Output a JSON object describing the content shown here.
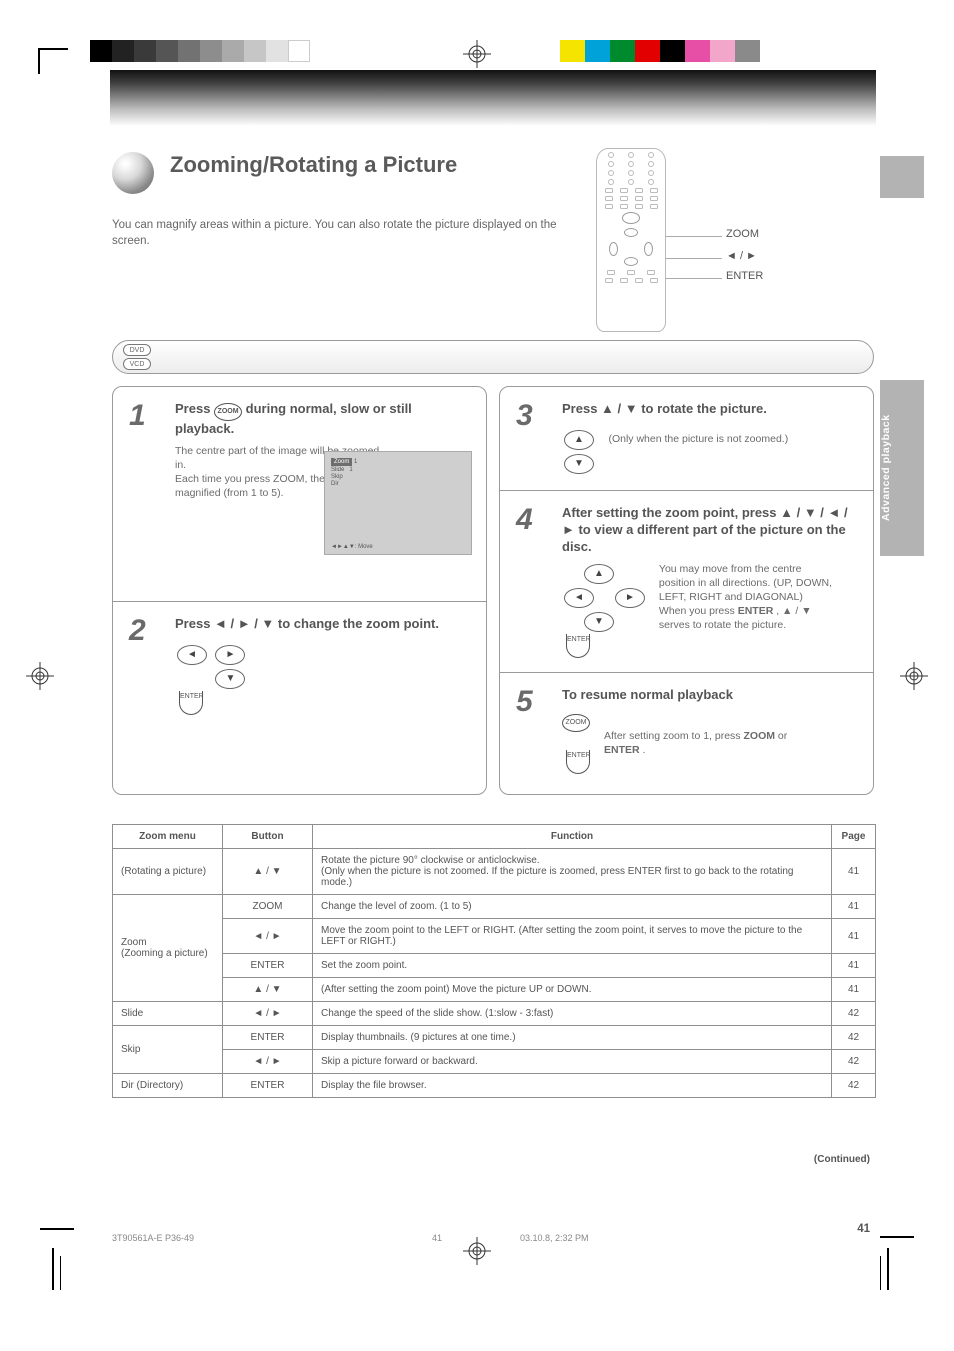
{
  "page_title": "Zooming/Rotating a Picture",
  "subtitle": "You can magnify areas within a picture. You can also rotate the picture displayed on the screen.",
  "side_tab": "Advanced playback",
  "remote_labels": {
    "zoom": "ZOOM",
    "arrows": "◄ / ►",
    "enter": "ENTER"
  },
  "pill": {
    "top": "DVD",
    "bottom": "VCD"
  },
  "steps": [
    {
      "num": "1",
      "title_pre": "Press ",
      "title_btn": "ZOOM",
      "title_post": " during normal, slow or still playback.",
      "body": "The centre part of the image will be zoomed in.\nEach time you press ZOOM, the picture is magnified (from 1 to 5).",
      "screen": {
        "hint": "◄►▲▼: Move",
        "zoom_label": "Zoom",
        "level": "1"
      }
    },
    {
      "num": "2",
      "title": "Press ◄ / ► / ▼ to change the zoom point.",
      "body": "",
      "enter": "ENTER"
    },
    {
      "num": "3",
      "title": "Press ▲ / ▼ to rotate the picture.",
      "body": "(Only when the picture is not zoomed.)"
    },
    {
      "num": "4",
      "title": "After setting the zoom point, press ▲ / ▼ / ◄ / ► to view a different part of the picture on the disc.",
      "body_pre": "You may move from the centre position in all directions. (UP, DOWN, LEFT, RIGHT and DIAGONAL)\nWhen you press ",
      "body_btn": "ENTER",
      "body_post": ", ▲ / ▼ serves to rotate the picture.",
      "enter": "ENTER"
    },
    {
      "num": "5",
      "title": "To resume normal playback",
      "body_pre": "After setting zoom to 1, press ",
      "body_btn1": "ZOOM",
      "body_mid": " or ",
      "body_btn2": "ENTER",
      "body_post": ".",
      "zoom": "ZOOM",
      "enter": "ENTER"
    }
  ],
  "table": {
    "headers": [
      "Zoom menu",
      "Button",
      "Function",
      "Page"
    ],
    "rows": [
      {
        "menu": "(Rotating a picture)",
        "button": "▲ / ▼",
        "function": "Rotate the picture 90° clockwise or anticlockwise.",
        "note": "(Only when the picture is not zoomed. If the picture is zoomed, press ENTER first to go back to the rotating mode.)",
        "page": "41"
      },
      {
        "menu": "Zoom",
        "menu_note": "(Zooming a picture)",
        "sub": [
          {
            "button": "ZOOM",
            "function": "Change the level of zoom. (1 to 5)",
            "page": "41"
          },
          {
            "button": "◄ / ►",
            "function": "Move the zoom point to the LEFT or RIGHT. (After setting the zoom point, it serves to move the picture to the LEFT or RIGHT.)",
            "page": "41"
          },
          {
            "button": "ENTER",
            "function": "Set the zoom point.",
            "page": "41"
          },
          {
            "button": "▲ / ▼",
            "function": "(After setting the zoom point) Move the picture UP or DOWN.",
            "page": "41"
          }
        ]
      },
      {
        "menu": "Slide",
        "button": "◄ / ►",
        "function": "Change the speed of the slide show. (1:slow - 3:fast)",
        "page": "42"
      },
      {
        "menu": "Skip",
        "sub": [
          {
            "button": "ENTER",
            "function": "Display thumbnails. (9 pictures at one time.)",
            "page": "42"
          },
          {
            "button": "◄ / ►",
            "function": "Skip a picture forward or backward.",
            "page": "42"
          }
        ]
      },
      {
        "menu": "Dir (Directory)",
        "button": "ENTER",
        "function": "Display the file browser.",
        "page": "42"
      }
    ]
  },
  "continued": "(Continued)",
  "page_number": "41",
  "footer_file": "3T90561A-E  P36-49",
  "footer_meta": "03.10.8, 2:32 PM"
}
